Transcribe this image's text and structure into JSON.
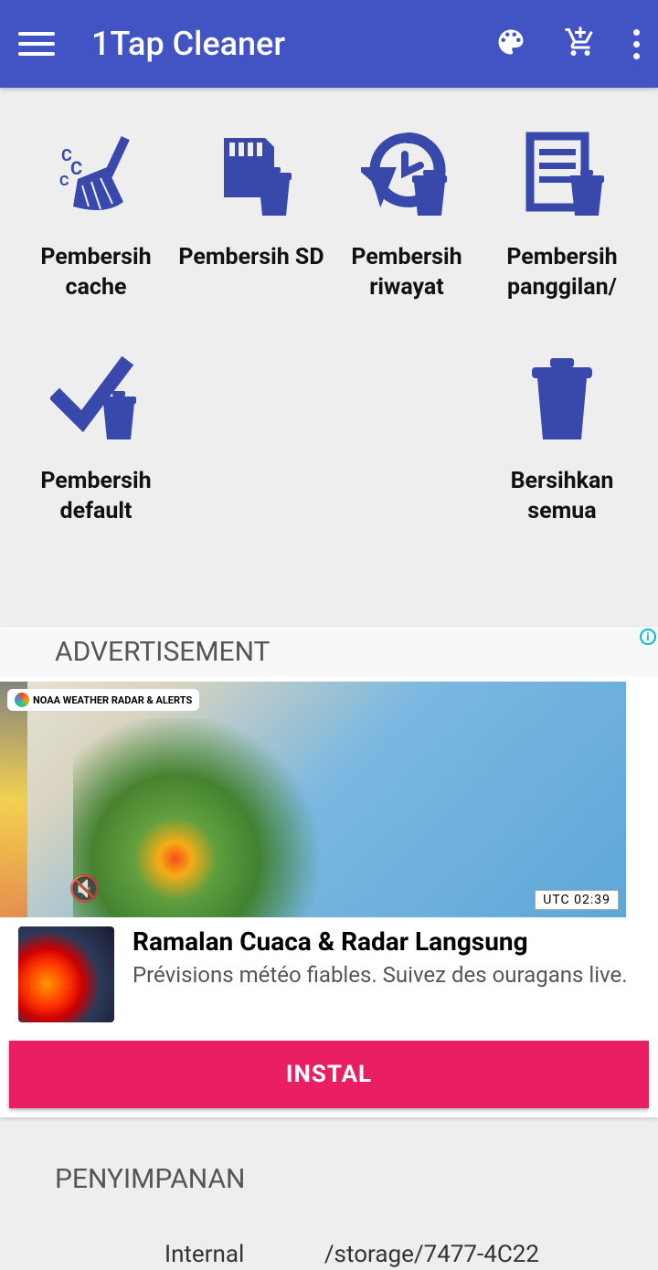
{
  "header": {
    "title": "1Tap Cleaner"
  },
  "grid": [
    {
      "label": "Pembersih cache",
      "icon": "broom"
    },
    {
      "label": "Pembersih SD",
      "icon": "sdcard"
    },
    {
      "label": "Pembersih riwayat",
      "icon": "history"
    },
    {
      "label": "Pembersih panggilan/",
      "icon": "calls"
    },
    {
      "label": "Pembersih default",
      "icon": "default"
    },
    {
      "label": "",
      "icon": ""
    },
    {
      "label": "",
      "icon": ""
    },
    {
      "label": "Bersihkan semua",
      "icon": "trash"
    }
  ],
  "ad": {
    "section_label": "ADVERTISEMENT",
    "map_badge": "NOAA WEATHER RADAR & ALERTS",
    "time_badge": "UTC 02:39",
    "title": "Ramalan Cuaca & Radar Langsung",
    "description": "Prévisions météo fiables. Suivez des ouragans live.",
    "button": "INSTAL"
  },
  "storage": {
    "title": "PENYIMPANAN",
    "internal_label": "Internal",
    "external_path": "/storage/7477-4C22"
  }
}
